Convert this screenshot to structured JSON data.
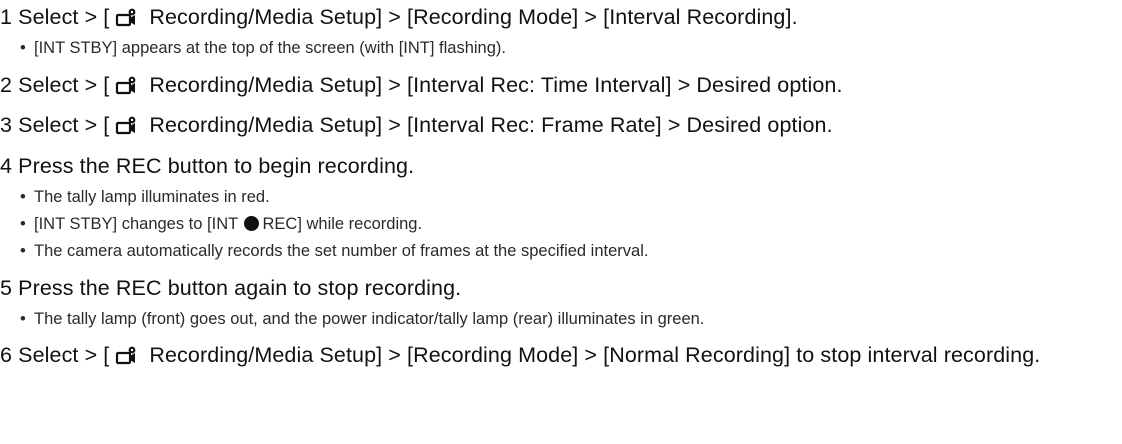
{
  "steps": [
    {
      "number": "1",
      "lead": "Select > [",
      "tail": "Recording/Media Setup] > [Recording Mode] > [Interval Recording].",
      "bullets": [
        {
          "text": "[INT STBY] appears at the top of the screen (with [INT] flashing)."
        }
      ]
    },
    {
      "number": "2",
      "lead": "Select > [",
      "tail": "Recording/Media Setup] > [Interval Rec: Time Interval] > Desired option."
    },
    {
      "number": "3",
      "lead": "Select > [",
      "tail": "Recording/Media Setup] > [Interval Rec: Frame Rate] > Desired option."
    },
    {
      "number": "4",
      "text": "Press the REC button to begin recording.",
      "bullets": [
        {
          "text": "The tally lamp illuminates in red."
        },
        {
          "before": "[INT STBY] changes to [INT ",
          "after": "REC] while recording."
        },
        {
          "text": "The camera automatically records the set number of frames at the specified interval."
        }
      ]
    },
    {
      "number": "5",
      "text": "Press the REC button again to stop recording.",
      "bullets": [
        {
          "text": "The tally lamp (front) goes out, and the power indicator/tally lamp (rear) illuminates in green."
        }
      ]
    },
    {
      "number": "6",
      "lead": "Select > [",
      "tail": "Recording/Media Setup] > [Recording Mode] > [Normal Recording] to stop interval recording."
    }
  ],
  "bullet_glyph": "•",
  "icons": {
    "menu": "recording-setup-camera-icon",
    "rec": "record-dot-icon"
  }
}
